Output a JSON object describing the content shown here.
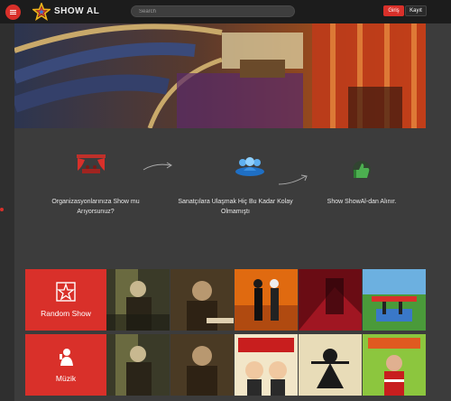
{
  "header": {
    "brand": "SHOW AL",
    "search_placeholder": "Search",
    "login_label": "Giriş",
    "register_label": "Kayıt"
  },
  "features": [
    {
      "text_line1": "Organizasyonlarınıza Show mu",
      "text_line2": "Arıyorsunuz?",
      "icon": "stage-icon"
    },
    {
      "text_line1": "Sanatçılara Ulaşmak Hiç Bu Kadar Kolay",
      "text_line2": "Olmamıştı",
      "icon": "people-group-icon"
    },
    {
      "text_line1": "Show ShowAl-dan Alınır.",
      "text_line2": "",
      "icon": "thumbs-up-icon"
    }
  ],
  "categories": [
    {
      "label": "Random Show",
      "icon": "star-icon"
    },
    {
      "label": "Müzik",
      "icon": "singer-icon"
    }
  ],
  "colors": {
    "accent": "#d9302a",
    "background": "#3c3c3c",
    "topbar": "#1c1c1c"
  }
}
